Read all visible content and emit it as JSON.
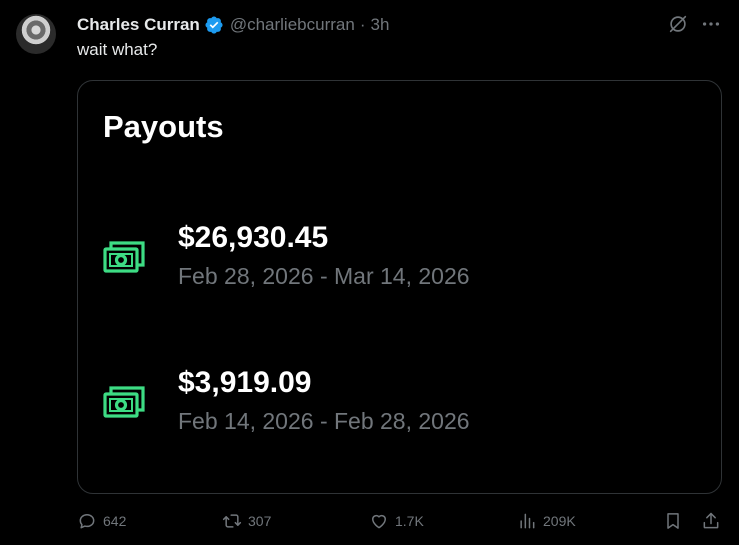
{
  "post": {
    "author_name": "Charles Curran",
    "handle": "@charliebcurran",
    "separator": "·",
    "time": "3h",
    "text": "wait what?"
  },
  "card": {
    "title": "Payouts",
    "payouts": [
      {
        "amount": "$26,930.45",
        "range": "Feb 28, 2026 - Mar 14, 2026"
      },
      {
        "amount": "$3,919.09",
        "range": "Feb 14, 2026 - Feb 28, 2026"
      }
    ]
  },
  "actions": {
    "replies": "642",
    "reposts": "307",
    "likes": "1.7K",
    "views": "209K"
  },
  "colors": {
    "verified": "#1d9bf0",
    "money_icon": "#3ddc84",
    "muted": "#71767b",
    "border": "#2f3336"
  }
}
